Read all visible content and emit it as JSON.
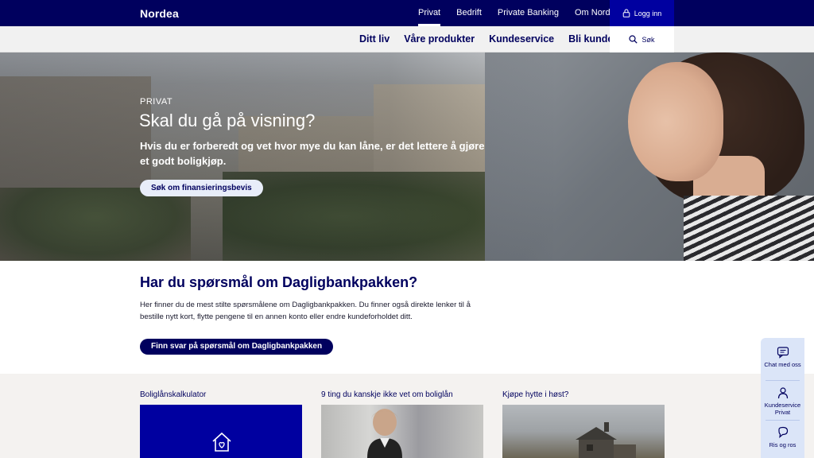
{
  "header": {
    "logo": "Nordea",
    "top_nav": [
      "Privat",
      "Bedrift",
      "Private Banking",
      "Om Nordea"
    ],
    "login_label": "Logg inn",
    "main_nav": [
      "Ditt liv",
      "Våre produkter",
      "Kundeservice",
      "Bli kunde"
    ],
    "search_label": "Søk"
  },
  "hero": {
    "eyebrow": "PRIVAT",
    "title": "Skal du gå på visning?",
    "text": "Hvis du er forberedt og vet hvor mye du kan låne, er det lettere å gjøre et godt boligkjøp.",
    "button": "Søk om finansieringsbevis"
  },
  "faq": {
    "title": "Har du spørsmål om Dagligbankpakken?",
    "text": "Her finner du de mest stilte spørsmålene om Dagligbankpakken. Du finner også direkte lenker til å bestille nytt kort, flytte pengene til en annen konto eller endre kundeforholdet ditt.",
    "button": "Finn svar på spørsmål om Dagligbankpakken"
  },
  "cards": [
    {
      "title": "Boliglånskalkulator",
      "icon": "house-heart-icon"
    },
    {
      "title": "9 ting du kanskje ikke vet om boliglån"
    },
    {
      "title": "Kjøpe hytte i høst?"
    }
  ],
  "side_widget": {
    "chat": "Chat med oss",
    "service": "Kundeservice Privat",
    "feedback": "Ris og ros"
  },
  "colors": {
    "brand_dark": "#00005e",
    "brand_blue": "#0000a0",
    "hero_button_bg": "#e8edf9",
    "side_widget_bg": "#dbe5f8"
  }
}
